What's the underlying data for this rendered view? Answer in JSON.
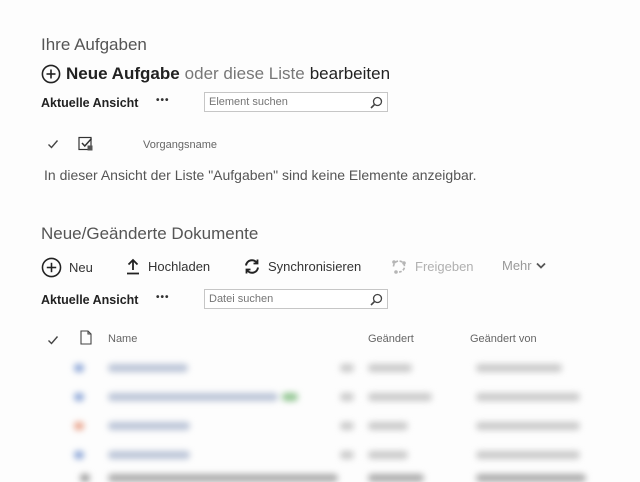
{
  "tasks": {
    "heading": "Ihre Aufgaben",
    "new_task_label": "Neue Aufgabe",
    "or_edit_prefix": "oder diese Liste",
    "edit_label": "bearbeiten",
    "view_label": "Aktuelle Ansicht",
    "more_dots": "•••",
    "search_placeholder": "Element suchen",
    "column_task_name": "Vorgangsname",
    "empty_message": "In dieser Ansicht der Liste \"Aufgaben\" sind keine Elemente anzeigbar."
  },
  "documents": {
    "heading": "Neue/Geänderte Dokumente",
    "toolbar": {
      "new_label": "Neu",
      "upload_label": "Hochladen",
      "sync_label": "Synchronisieren",
      "share_label": "Freigeben",
      "more_label": "Mehr"
    },
    "view_label": "Aktuelle Ansicht",
    "more_dots": "•••",
    "search_placeholder": "Datei suchen",
    "columns": {
      "name": "Name",
      "modified": "Geändert",
      "modified_by": "Geändert von"
    }
  },
  "colors": {
    "blurred_doc_icon": "#8aa4d6",
    "blurred_ppt_icon": "#e9a28a",
    "blurred_excel_icon": "#8fc48f",
    "disabled_text": "#b0b0b0"
  }
}
